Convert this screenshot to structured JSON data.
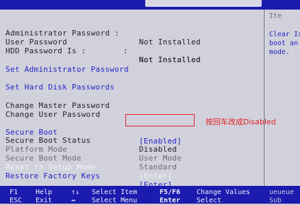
{
  "rows": [
    {
      "label": "Administrator Password :",
      "value": "Not Installed",
      "style": "dark"
    },
    {
      "label": "User Password",
      "value": "Not Installed",
      "sep": ":",
      "style": "dark"
    },
    {
      "label": "HDD Password Is :",
      "value": "Not Installed",
      "style": "dark"
    },
    {
      "label": "Set Administrator Password",
      "style": "blue"
    },
    {
      "label": "Set Hard Disk Passwords",
      "style": "blue"
    },
    {
      "label": "Change Master Password",
      "style": "dark"
    },
    {
      "label": "Change User Password",
      "style": "dark"
    },
    {
      "label": "Secure Boot",
      "value": "[Enabled]",
      "style": "blue"
    },
    {
      "label": "Secure Boot Status",
      "value": "Disabled",
      "style": "dark"
    },
    {
      "label": "Platform Mode",
      "value": "User Mode",
      "style": "grey"
    },
    {
      "label": "Secure Boot Mode",
      "value": "Standard",
      "style": "grey"
    },
    {
      "label": "Reset to Setup Mode",
      "value": "[Enter]",
      "style": "white"
    },
    {
      "label": "Restore Factory Keys",
      "value": "[Enter]",
      "style": "blue"
    }
  ],
  "help": {
    "title": "Ite",
    "text": "Clear Is\nboot an\nmode."
  },
  "annotation": {
    "text": "按回车改成Disabled",
    "color": "#e02020"
  },
  "bottom": {
    "f1_key": "F1",
    "f1_desc": "Help",
    "esc_key": "ESC",
    "esc_desc": "Exit",
    "ud_key": "↑↓",
    "ud_desc": "Select Item",
    "lr_key": "↔",
    "lr_desc": "Select Menu",
    "f5_key": "F5/F6",
    "f5_desc": "Change Values",
    "enter_key": "Enter",
    "enter_desc": "Select",
    "extra_top": "ueueue",
    "extra_bottom": "Sub"
  },
  "colors": {
    "screen_bg": "#d1d1dc",
    "bar_blue": "#1b1bb0",
    "text_blue": "#2323c8",
    "text_dark": "#1e1e2e",
    "text_grey": "#6a6a78",
    "annotation_red": "#e02020"
  }
}
